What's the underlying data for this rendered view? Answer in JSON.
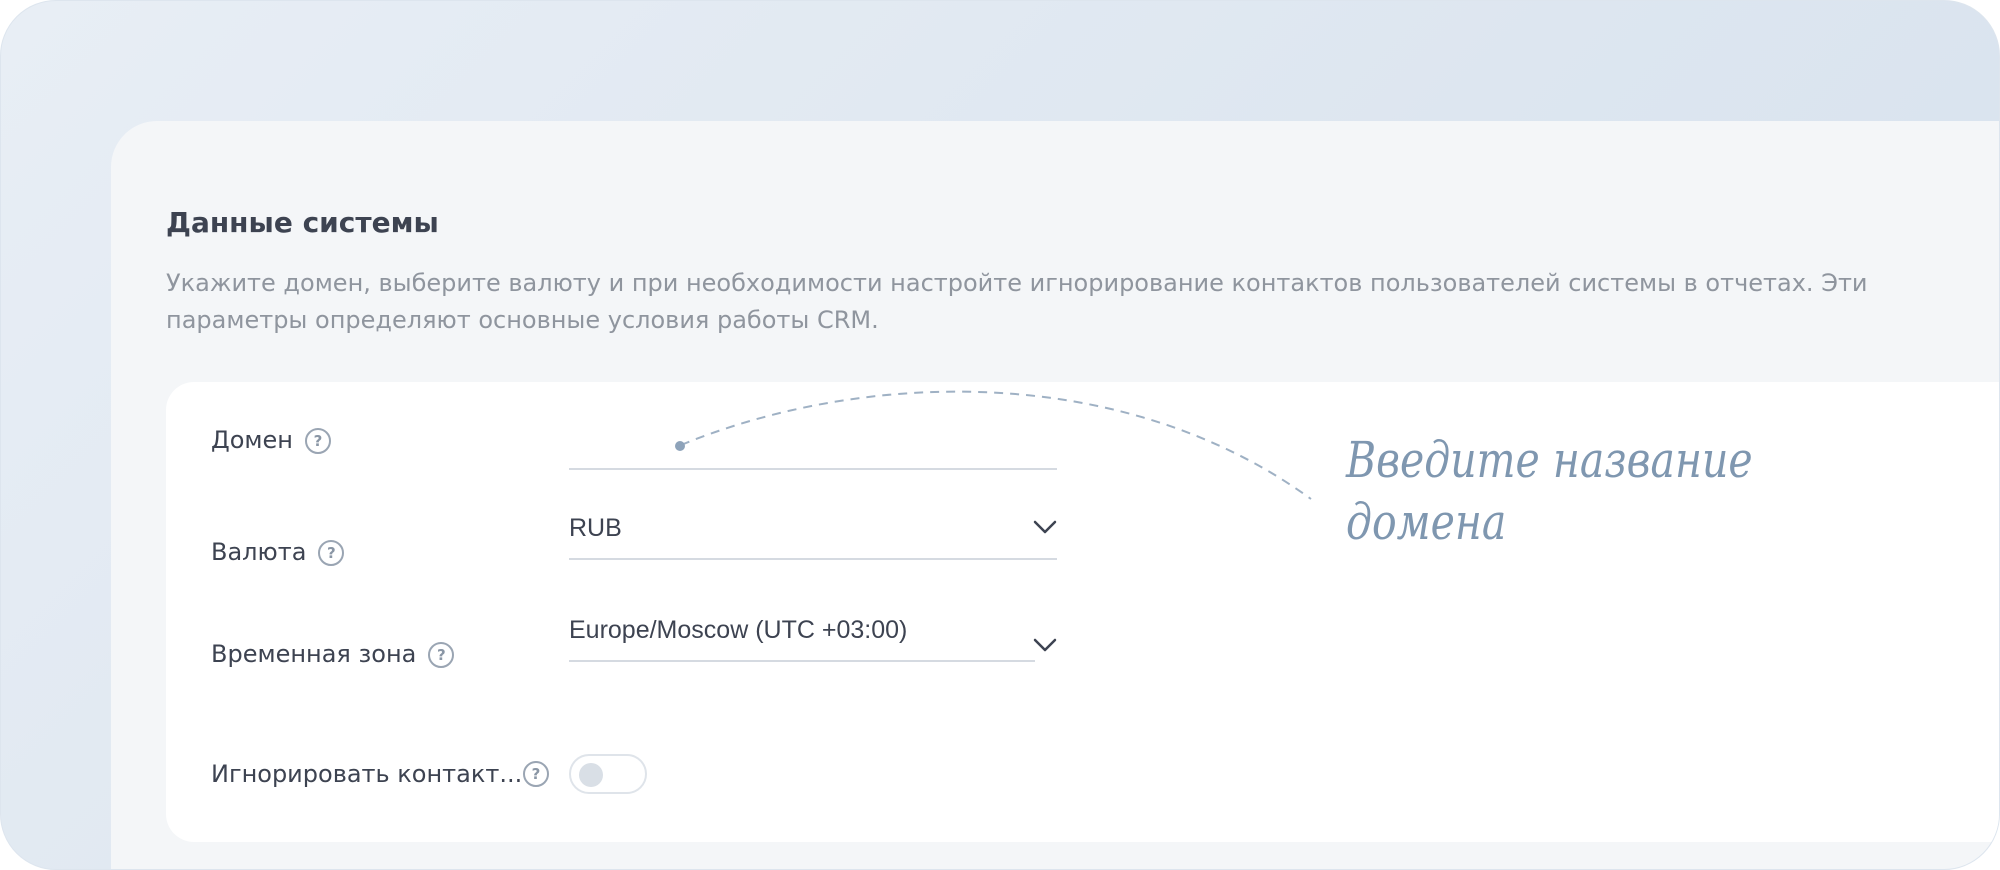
{
  "section": {
    "title": "Данные системы",
    "description": "Укажите домен, выберите валюту и при необходимости настройте игнорирование контактов пользователей системы в отчетах. Эти параметры определяют основные условия работы CRM."
  },
  "help_glyph": "?",
  "fields": {
    "domain": {
      "label": "Домен",
      "value": ""
    },
    "currency": {
      "label": "Валюта",
      "value": "RUB"
    },
    "timezone": {
      "label": "Временная зона",
      "value": "Europe/Moscow (UTC +03:00)"
    },
    "ignore_contacts": {
      "label": "Игнорировать контакт...",
      "enabled": false
    }
  },
  "annotation": {
    "line1": "Введите название",
    "line2": "домена"
  },
  "colors": {
    "accent_annotation": "#7f97b0",
    "text_primary": "#3d4351",
    "text_secondary": "#8f959e",
    "border": "#d5dae1"
  },
  "icons": {
    "help": "help-icon",
    "chevron": "chevron-down-icon"
  }
}
